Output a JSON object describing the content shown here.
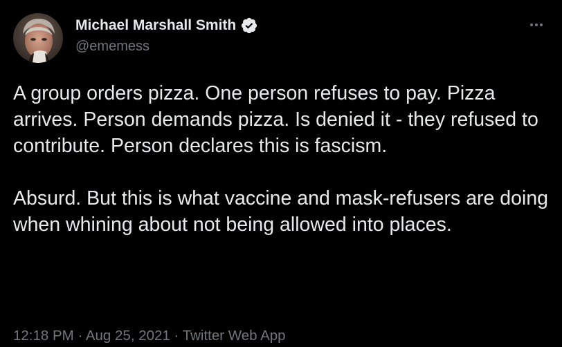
{
  "author": {
    "display_name": "Michael Marshall Smith",
    "handle": "@ememess",
    "verified": true,
    "avatar_icon": "profile-photo"
  },
  "tweet": {
    "paragraphs": [
      "A group orders pizza. One person refuses to pay. Pizza arrives. Person demands pizza. Is denied it - they refused to contribute. Person declares this is fascism.",
      "Absurd. But this is what vaccine and mask-refusers are doing when whining about not being allowed into places."
    ],
    "time": "12:18 PM",
    "date": "Aug 25, 2021",
    "source": "Twitter Web App",
    "separator": "·"
  },
  "menu": {
    "more_icon": "more-horizontal-icon"
  },
  "colors": {
    "background": "#000000",
    "primary_text": "#e7e9ea",
    "secondary_text": "#71767b",
    "verified_badge": "#e7e9ea"
  }
}
